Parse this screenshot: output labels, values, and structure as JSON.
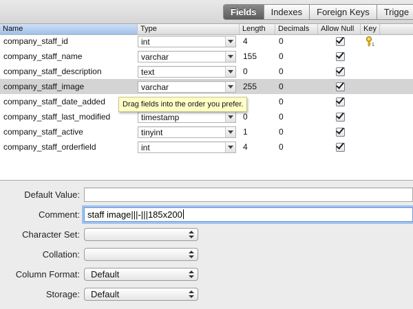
{
  "tabs": [
    {
      "label": "Fields",
      "active": true
    },
    {
      "label": "Indexes",
      "active": false
    },
    {
      "label": "Foreign Keys",
      "active": false
    },
    {
      "label": "Trigge",
      "active": false
    }
  ],
  "table": {
    "columns": [
      "Name",
      "Type",
      "Length",
      "Decimals",
      "Allow Null",
      "Key"
    ],
    "rows": [
      {
        "name": "company_staff_id",
        "type": "int",
        "length": "4",
        "decimals": "0",
        "allow_null": true,
        "key": "primary-key-icon"
      },
      {
        "name": "company_staff_name",
        "type": "varchar",
        "length": "155",
        "decimals": "0",
        "allow_null": true,
        "key": ""
      },
      {
        "name": "company_staff_description",
        "type": "text",
        "length": "0",
        "decimals": "0",
        "allow_null": true,
        "key": ""
      },
      {
        "name": "company_staff_image",
        "type": "varchar",
        "length": "255",
        "decimals": "0",
        "allow_null": true,
        "key": "",
        "selected": true
      },
      {
        "name": "company_staff_date_added",
        "type": "",
        "length": "",
        "decimals": "0",
        "allow_null": true,
        "key": ""
      },
      {
        "name": "company_staff_last_modified",
        "type": "timestamp",
        "length": "0",
        "decimals": "0",
        "allow_null": true,
        "key": ""
      },
      {
        "name": "company_staff_active",
        "type": "tinyint",
        "length": "1",
        "decimals": "0",
        "allow_null": true,
        "key": ""
      },
      {
        "name": "company_staff_orderfield",
        "type": "int",
        "length": "4",
        "decimals": "0",
        "allow_null": true,
        "key": ""
      }
    ],
    "tooltip": "Drag fields into the order you prefer."
  },
  "form": {
    "default_value": {
      "label": "Default Value:",
      "value": ""
    },
    "comment": {
      "label": "Comment:",
      "value": "staff image|||-|||185x200"
    },
    "character_set": {
      "label": "Character Set:",
      "value": ""
    },
    "collation": {
      "label": "Collation:",
      "value": ""
    },
    "column_format": {
      "label": "Column Format:",
      "value": "Default"
    },
    "storage": {
      "label": "Storage:",
      "value": "Default"
    }
  },
  "colors": {
    "selected_row": "#d4d4d4",
    "tooltip_bg": "#ffffc6",
    "focus_ring": "#9ec2ee"
  }
}
